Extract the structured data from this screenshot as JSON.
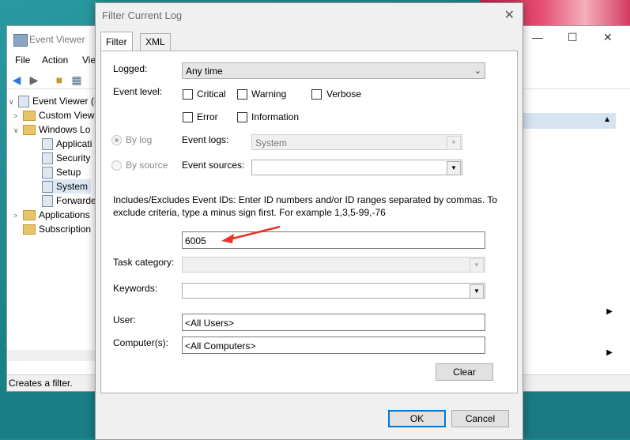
{
  "event_viewer": {
    "title": "Event Viewer",
    "menu": [
      "File",
      "Action",
      "Vie"
    ],
    "tree": [
      {
        "label": "Event Viewer (Lo",
        "kind": "root"
      },
      {
        "label": "Custom View",
        "kind": "folder"
      },
      {
        "label": "Windows Lo",
        "kind": "folder"
      },
      {
        "label": "Applicati",
        "kind": "log"
      },
      {
        "label": "Security",
        "kind": "log"
      },
      {
        "label": "Setup",
        "kind": "log"
      },
      {
        "label": "System",
        "kind": "log"
      },
      {
        "label": "Forwarde",
        "kind": "log"
      },
      {
        "label": "Applications",
        "kind": "folder"
      },
      {
        "label": "Subscription",
        "kind": "folder"
      }
    ],
    "status": "Creates a filter."
  },
  "dialog": {
    "title": "Filter Current Log",
    "tabs": [
      "Filter",
      "XML"
    ],
    "logged_label": "Logged:",
    "logged_value": "Any time",
    "event_level_label": "Event level:",
    "levels": {
      "critical": "Critical",
      "warning": "Warning",
      "verbose": "Verbose",
      "error": "Error",
      "information": "Information"
    },
    "by_log": "By log",
    "by_source": "By source",
    "event_logs_label": "Event logs:",
    "event_logs_value": "System",
    "event_sources_label": "Event sources:",
    "description": "Includes/Excludes Event IDs: Enter ID numbers and/or ID ranges separated by commas. To exclude criteria, type a minus sign first. For example 1,3,5-99,-76",
    "event_ids_value": "6005",
    "task_category_label": "Task category:",
    "keywords_label": "Keywords:",
    "user_label": "User:",
    "user_value": "<All Users>",
    "computer_label": "Computer(s):",
    "computer_value": "<All Computers>",
    "clear_button": "Clear",
    "ok_button": "OK",
    "cancel_button": "Cancel"
  },
  "colors": {
    "annotation_arrow": "#e8342a",
    "default_button_border": "#0078d7"
  }
}
